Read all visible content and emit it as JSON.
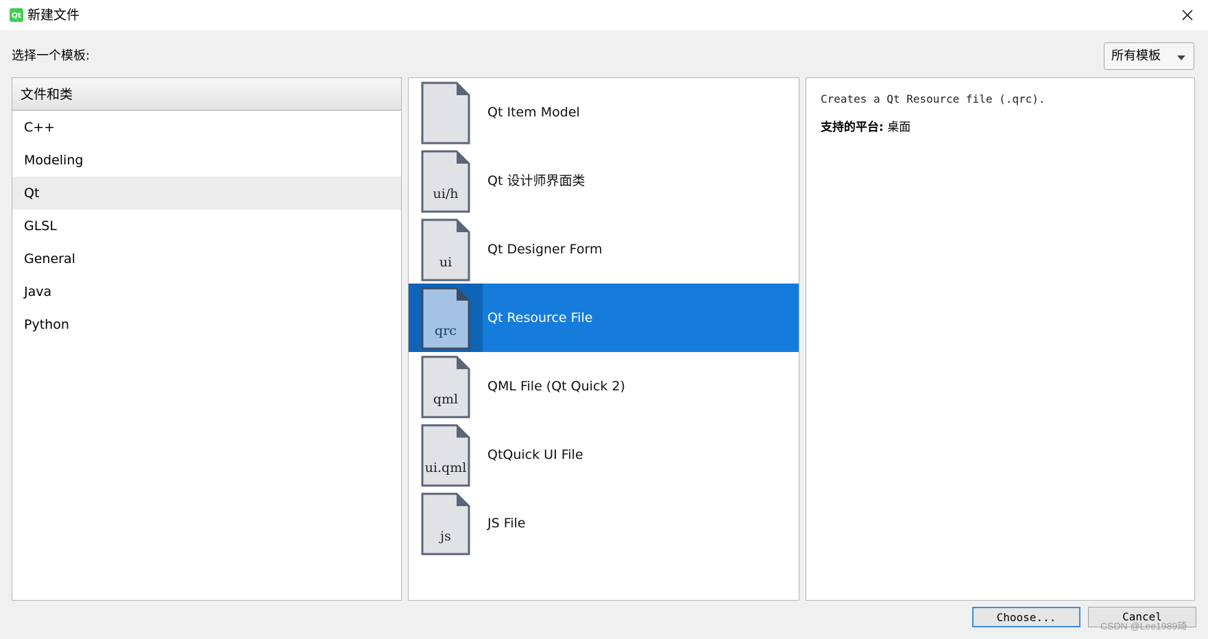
{
  "window": {
    "title": "新建文件",
    "app_icon_text": "Qt"
  },
  "header": {
    "select_label": "选择一个模板:",
    "filter_combo": "所有模板"
  },
  "categories": {
    "header": "文件和类",
    "items": [
      "C++",
      "Modeling",
      "Qt",
      "GLSL",
      "General",
      "Java",
      "Python"
    ],
    "selected": "Qt"
  },
  "templates": [
    {
      "name": "Qt Item Model",
      "ext": "",
      "selected": false
    },
    {
      "name": "Qt 设计师界面类",
      "ext": "ui/h",
      "selected": false
    },
    {
      "name": "Qt Designer Form",
      "ext": "ui",
      "selected": false
    },
    {
      "name": "Qt Resource File",
      "ext": "qrc",
      "selected": true
    },
    {
      "name": "QML File (Qt Quick 2)",
      "ext": "qml",
      "selected": false
    },
    {
      "name": "QtQuick UI File",
      "ext": "ui.qml",
      "selected": false
    },
    {
      "name": "JS File",
      "ext": "js",
      "selected": false
    }
  ],
  "details": {
    "description": "Creates a Qt Resource file (.qrc).",
    "platform_label": "支持的平台:",
    "platform_value": "桌面"
  },
  "buttons": {
    "choose": "Choose...",
    "cancel": "Cancel"
  },
  "watermark": "CSDN @Lee1989琦",
  "colors": {
    "selection": "#167cdc",
    "app_icon": "#41cd52"
  }
}
